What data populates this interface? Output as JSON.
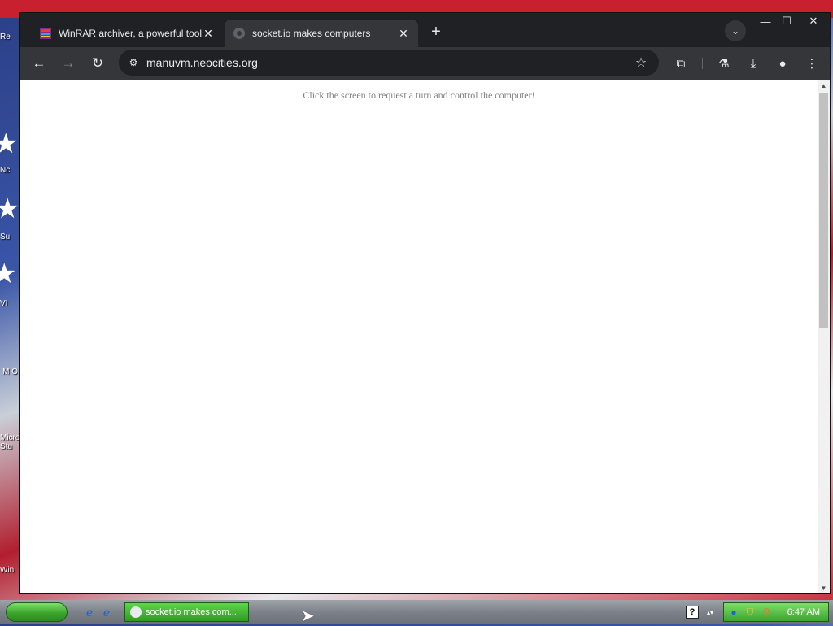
{
  "desktop": {
    "icon_labels": [
      "Re",
      "Nc",
      "Su",
      "VI",
      "M O",
      "Micro Stu",
      "Win"
    ]
  },
  "browser": {
    "tabs": [
      {
        "title": "WinRAR archiver, a powerful tool t",
        "active": false,
        "favicon": "winrar-icon"
      },
      {
        "title": "socket.io makes computers",
        "active": true,
        "favicon": "globe-icon"
      }
    ],
    "new_tab_label": "+",
    "tab_search_glyph": "⌄",
    "window_buttons": {
      "minimize": "—",
      "maximize": "☐",
      "close": "✕"
    },
    "toolbar": {
      "back": "←",
      "forward": "→",
      "reload": "↻",
      "url": "manuvm.neocities.org",
      "site_info": "⚙",
      "bookmark": "☆",
      "extensions": "⧉",
      "labs": "⚗",
      "download": "⤓",
      "profile": "●",
      "menu": "⋮"
    }
  },
  "page": {
    "message": "Click the screen to request a turn and control the computer!"
  },
  "taskbar": {
    "task_button_label": "socket.io makes com...",
    "quick_launch": [
      "ie-icon",
      "ie-alt-icon"
    ],
    "tray_help": "?",
    "clock": "6:47 AM",
    "colors": {
      "accent_green": "#3aa52c",
      "bar_gray": "#7d828a"
    }
  }
}
